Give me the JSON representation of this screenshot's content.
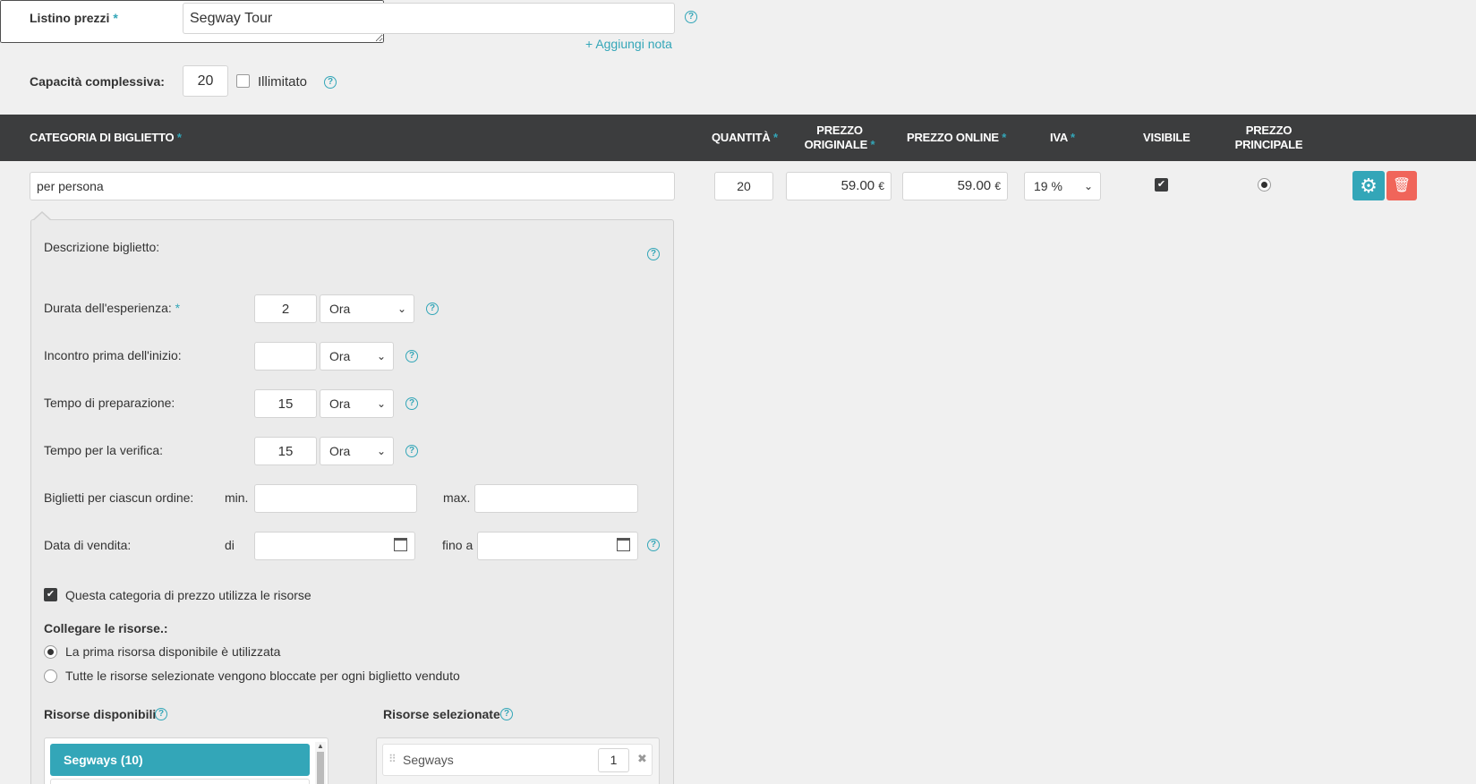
{
  "form": {
    "listino_label": "Listino prezzi",
    "listino_value": "Segway Tour",
    "add_note_label": "Aggiungi nota",
    "capacity_label": "Capacità complessiva:",
    "capacity_value": "20",
    "unlimited_label": "Illimitato"
  },
  "table_header": {
    "category": "CATEGORIA DI BIGLIETTO",
    "quantity": "QUANTITÀ",
    "original_price_1": "PREZZO",
    "original_price_2": "ORIGINALE",
    "online_price": "PREZZO ONLINE",
    "vat": "IVA",
    "visible": "VISIBILE",
    "main_price_1": "PREZZO",
    "main_price_2": "PRINCIPALE",
    "required_mark": "*"
  },
  "ticket_row": {
    "category_value": "per persona",
    "quantity_value": "20",
    "original_price": "59.00",
    "online_price": "59.00",
    "currency": "€",
    "vat_value": "19 %",
    "visible_checked": true,
    "main_price_selected": true
  },
  "details": {
    "description_label": "Descrizione biglietto:",
    "duration_label": "Durata dell'esperienza:",
    "duration_value": "2",
    "duration_unit": "Ora",
    "meeting_label": "Incontro prima dell'inizio:",
    "meeting_value": "",
    "meeting_unit": "Ora",
    "prep_label": "Tempo di preparazione:",
    "prep_value": "15",
    "prep_unit": "Ora",
    "check_label": "Tempo per la verifica:",
    "check_value": "15",
    "check_unit": "Ora",
    "tickets_per_order_label": "Biglietti per ciascun ordine:",
    "min_label": "min.",
    "max_label": "max.",
    "sale_date_label": "Data di vendita:",
    "from_label": "di",
    "to_label": "fino a",
    "uses_resources_label": "Questa categoria di prezzo utilizza le risorse",
    "connect_resources_label": "Collegare le risorse.:",
    "radio_first_label": "La prima risorsa disponibile è utilizzata",
    "radio_all_label": "Tutte le risorse selezionate vengono bloccate per ogni biglietto venduto",
    "available_resources_label": "Risorse disponibili",
    "selected_resources_label": "Risorse selezionate",
    "available_items": [
      "Segways (10)"
    ],
    "selected_items": [
      {
        "name": "Segways",
        "qty": "1"
      }
    ]
  },
  "colors": {
    "accent": "#33a6b8",
    "header_bg": "#3c3d3e",
    "delete": "#f0655a"
  }
}
